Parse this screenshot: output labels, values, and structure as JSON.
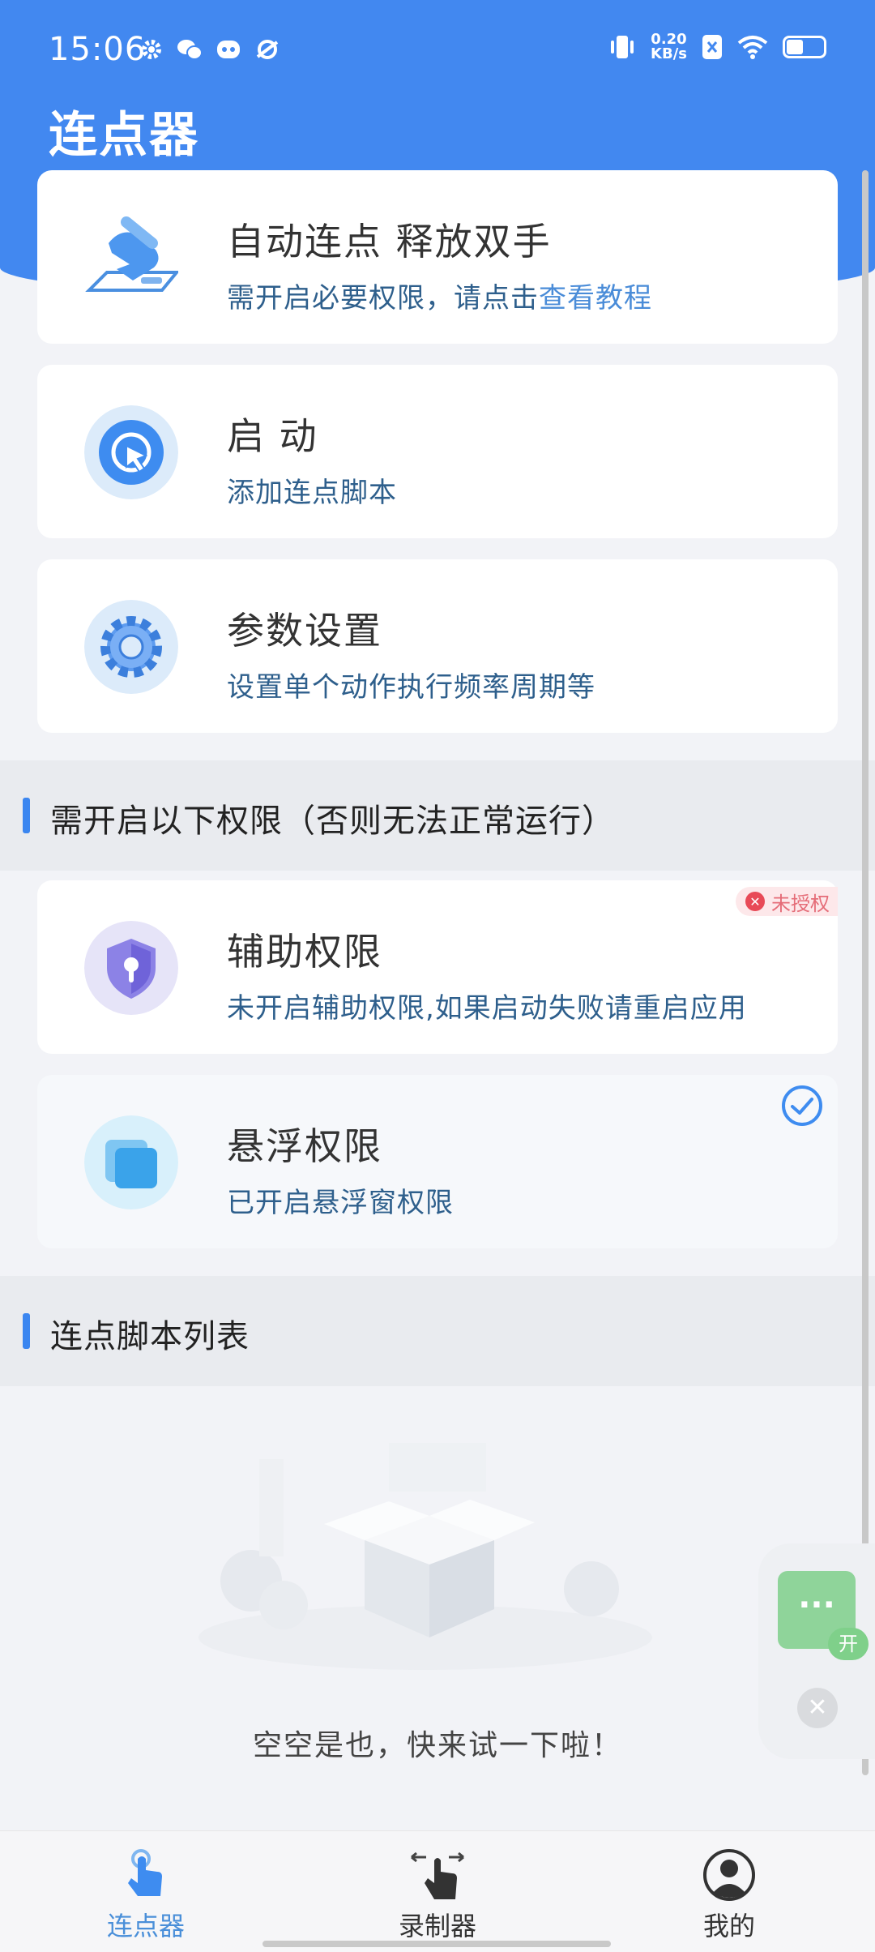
{
  "status_bar": {
    "time": "15:06",
    "net_speed_value": "0.20",
    "net_speed_unit": "KB/s",
    "left_icons": [
      "gear-icon",
      "wechat-icon",
      "app-icon",
      "planet-icon"
    ],
    "right_icons": [
      "vibrate-icon",
      "sim-off-icon",
      "wifi-icon",
      "battery-icon"
    ]
  },
  "app": {
    "title": "连点器"
  },
  "cards": [
    {
      "title": "自动连点 释放双手",
      "subtitle": "需开启必要权限，请点击",
      "link": "查看教程",
      "icon": "tap-hand-icon"
    },
    {
      "title": "启 动",
      "subtitle": "添加连点脚本",
      "icon": "pointer-click-icon"
    },
    {
      "title": "参数设置",
      "subtitle": "设置单个动作执行频率周期等",
      "icon": "settings-gear-icon"
    }
  ],
  "permissions_section": {
    "title": "需开启以下权限（否则无法正常运行）"
  },
  "permissions": [
    {
      "title": "辅助权限",
      "subtitle": "未开启辅助权限,如果启动失败请重启应用",
      "badge": "未授权",
      "icon": "shield-lock-icon",
      "granted": false
    },
    {
      "title": "悬浮权限",
      "subtitle": "已开启悬浮窗权限",
      "icon": "overlay-window-icon",
      "granted": true
    }
  ],
  "script_section": {
    "title": "连点脚本列表"
  },
  "empty_state": {
    "text": "空空是也，快来试一下啦！"
  },
  "float_widget": {
    "dots": "···",
    "open_label": "开"
  },
  "bottom_nav": [
    {
      "label": "连点器",
      "icon": "tap-hand-icon",
      "active": true
    },
    {
      "label": "录制器",
      "icon": "record-hand-icon",
      "active": false
    },
    {
      "label": "我的",
      "icon": "user-avatar-icon",
      "active": false
    }
  ],
  "colors": {
    "primary": "#4288f0",
    "link": "#4a8cd8",
    "warning": "#e84a57",
    "float_green": "#8fd49a"
  }
}
